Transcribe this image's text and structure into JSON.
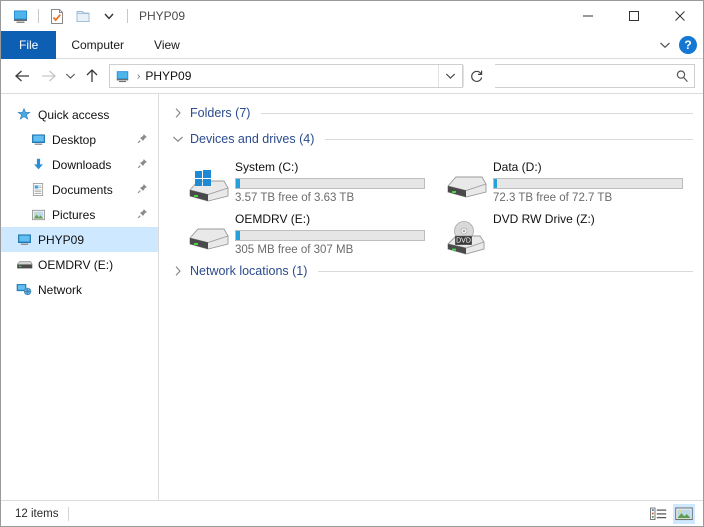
{
  "window": {
    "title": "PHYP09",
    "quick_access": [
      {
        "name": "this-pc-icon",
        "label": "This PC"
      },
      {
        "name": "properties-icon",
        "label": "Properties"
      },
      {
        "name": "new-folder-icon",
        "label": "New folder"
      },
      {
        "name": "customize-qat-icon",
        "label": "Customize Quick Access Toolbar"
      }
    ],
    "controls": {
      "minimize": "Minimize",
      "maximize": "Maximize",
      "close": "Close"
    }
  },
  "ribbon": {
    "tabs": [
      {
        "label": "File",
        "active": true
      },
      {
        "label": "Computer",
        "active": false
      },
      {
        "label": "View",
        "active": false
      }
    ],
    "expand_label": "Expand the Ribbon",
    "help_label": "?"
  },
  "nav": {
    "back": "Back",
    "forward": "Forward",
    "recent": "Recent locations",
    "up": "Up",
    "address": {
      "icon": "this-pc-icon",
      "crumbs": [
        "PHYP09"
      ],
      "separator": "›",
      "dropdown_label": "Previous locations",
      "refresh_label": "Refresh"
    },
    "search": {
      "value": "",
      "placeholder": "",
      "icon": "search-icon"
    }
  },
  "sidebar": {
    "items": [
      {
        "label": "Quick access",
        "icon": "star-pin-icon",
        "indent": false,
        "selected": false,
        "pinned": false
      },
      {
        "label": "Desktop",
        "icon": "desktop-icon",
        "indent": true,
        "selected": false,
        "pinned": true
      },
      {
        "label": "Downloads",
        "icon": "downloads-icon",
        "indent": true,
        "selected": false,
        "pinned": true
      },
      {
        "label": "Documents",
        "icon": "documents-icon",
        "indent": true,
        "selected": false,
        "pinned": true
      },
      {
        "label": "Pictures",
        "icon": "pictures-icon",
        "indent": true,
        "selected": false,
        "pinned": true
      },
      {
        "label": "PHYP09",
        "icon": "this-pc-icon",
        "indent": false,
        "selected": true,
        "pinned": false
      },
      {
        "label": "OEMDRV (E:)",
        "icon": "drive-icon",
        "indent": false,
        "selected": false,
        "pinned": false
      },
      {
        "label": "Network",
        "icon": "network-icon",
        "indent": false,
        "selected": false,
        "pinned": false
      }
    ]
  },
  "content": {
    "groups": [
      {
        "title": "Folders (7)",
        "expanded": false
      },
      {
        "title": "Devices and drives (4)",
        "expanded": true
      },
      {
        "title": "Network locations (1)",
        "expanded": false
      }
    ],
    "drives": [
      {
        "name": "System (C:)",
        "icon": "windows-drive-icon",
        "capacity_text": "3.57 TB free of 3.63 TB",
        "used_percent": 2,
        "has_bar": true
      },
      {
        "name": "Data (D:)",
        "icon": "drive-icon",
        "capacity_text": "72.3 TB free of 72.7 TB",
        "used_percent": 1,
        "has_bar": true
      },
      {
        "name": "OEMDRV (E:)",
        "icon": "drive-icon",
        "capacity_text": "305 MB free of 307 MB",
        "used_percent": 2,
        "has_bar": true
      },
      {
        "name": "DVD RW Drive (Z:)",
        "icon": "dvd-drive-icon",
        "capacity_text": "",
        "used_percent": 0,
        "has_bar": false
      }
    ]
  },
  "status": {
    "item_count": "12 items",
    "views": [
      {
        "name": "details-view-button",
        "label": "Details view",
        "active": false
      },
      {
        "name": "large-icons-view-button",
        "label": "Large icons view",
        "active": true
      }
    ]
  },
  "colors": {
    "accent": "#0c5fb3",
    "selection": "#cde8ff",
    "group_title": "#2a4b8d",
    "bar_fill": "#26a0da",
    "help_blue": "#1577d4"
  }
}
